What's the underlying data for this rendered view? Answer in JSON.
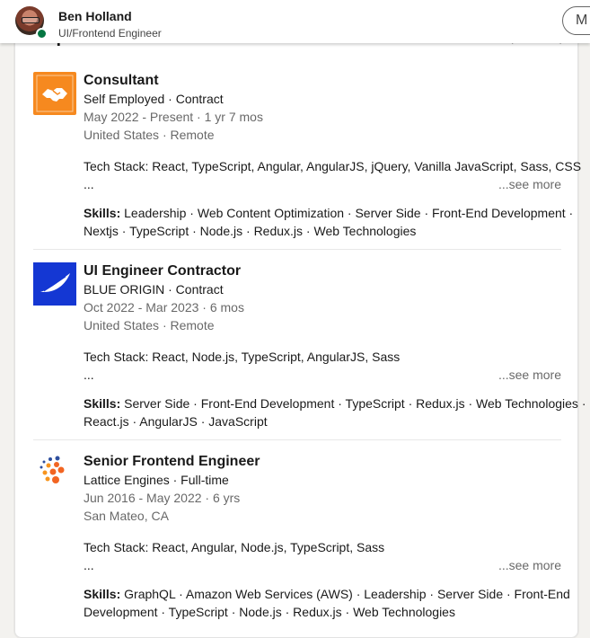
{
  "profile": {
    "name": "Ben Holland",
    "headline": "UI/Frontend Engineer",
    "more_button": "M"
  },
  "section": {
    "title": "Experience"
  },
  "experience": [
    {
      "title": "Consultant",
      "company_line": "Self Employed · Contract",
      "dates": "May 2022 - Present · 1 yr 7 mos",
      "location": "United States · Remote",
      "desc_line1": "Tech Stack: React, TypeScript, Angular, AngularJS, jQuery, Vanilla JavaScript, Sass, CSS",
      "desc_line2": "...",
      "see_more": "...see more",
      "skills_label": "Skills:",
      "skills_line1": " Leadership · Web Content Optimization · Server Side · Front-End Development ·",
      "skills_line2": "Nextjs · TypeScript · Node.js · Redux.js · Web Technologies",
      "logo_icon": "handshake-icon",
      "logo_color": "#f6891f"
    },
    {
      "title": "UI Engineer Contractor",
      "company_line": "BLUE ORIGIN · Contract",
      "dates": "Oct 2022 - Mar 2023 · 6 mos",
      "location": "United States · Remote",
      "desc_line1": "Tech Stack: React, Node.js, TypeScript, AngularJS, Sass",
      "desc_line2": "...",
      "see_more": "...see more",
      "skills_label": "Skills:",
      "skills_line1": " Server Side · Front-End Development · TypeScript · Redux.js · Web Technologies ·",
      "skills_line2": "React.js · AngularJS · JavaScript",
      "logo_icon": "feather-icon",
      "logo_color": "#1437d3"
    },
    {
      "title": "Senior Frontend Engineer",
      "company_line": "Lattice Engines · Full-time",
      "dates": "Jun 2016 - May 2022 · 6 yrs",
      "location": "San Mateo, CA",
      "desc_line1": "Tech Stack: React, Angular, Node.js, TypeScript, Sass",
      "desc_line2": "...",
      "see_more": "...see more",
      "skills_label": "Skills:",
      "skills_line1": " GraphQL · Amazon Web Services (AWS) · Leadership · Server Side · Front-End",
      "skills_line2": "Development · TypeScript · Node.js · Redux.js · Web Technologies",
      "logo_icon": "lattice-dots-icon",
      "logo_color": "#f26522"
    }
  ]
}
